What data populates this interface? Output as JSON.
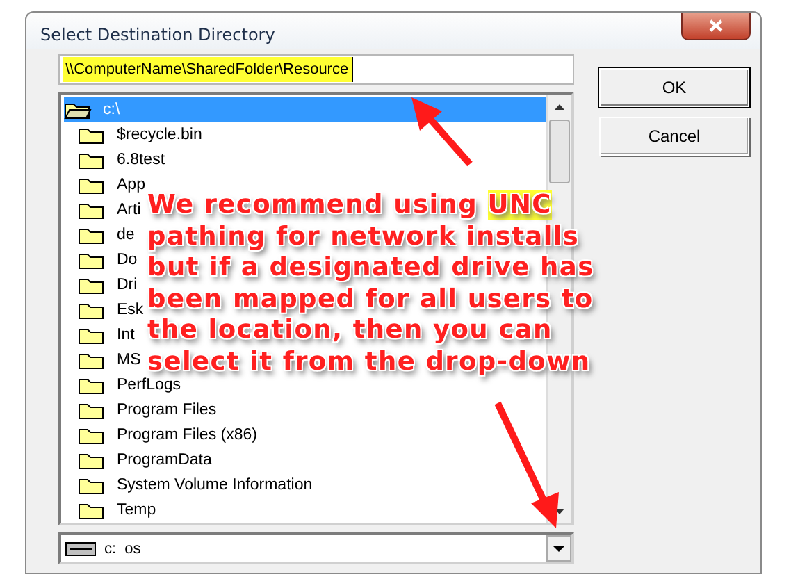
{
  "window": {
    "title": "Select Destination Directory"
  },
  "path_field": {
    "value": "\\\\ComputerName\\SharedFolder\\Resource",
    "highlighted": true
  },
  "buttons": [
    {
      "label": "OK",
      "default": true
    },
    {
      "label": "Cancel",
      "default": false
    }
  ],
  "folder_tree": {
    "label": "c:\\",
    "selected": true,
    "expanded": true,
    "children": [
      {
        "label": "$recycle.bin",
        "selected": false
      },
      {
        "label": "6.8test",
        "selected": false
      },
      {
        "label": "App",
        "selected": false
      },
      {
        "label": "Arti",
        "selected": false
      },
      {
        "label": "de",
        "selected": false
      },
      {
        "label": "Do",
        "selected": false
      },
      {
        "label": "Dri",
        "selected": false
      },
      {
        "label": "Esk",
        "selected": false
      },
      {
        "label": "Int",
        "selected": false
      },
      {
        "label": "MS",
        "selected": false
      },
      {
        "label": "PerfLogs",
        "selected": false
      },
      {
        "label": "Program Files",
        "selected": false
      },
      {
        "label": "Program Files (x86)",
        "selected": false
      },
      {
        "label": "ProgramData",
        "selected": false
      },
      {
        "label": "System Volume Information",
        "selected": false
      },
      {
        "label": "Temp",
        "selected": false
      }
    ]
  },
  "drive_dropdown": {
    "drive": "c:",
    "label": "os"
  },
  "annotation": {
    "lines": [
      {
        "segments": [
          {
            "text": "We recommend using ",
            "highlighted": false
          },
          {
            "text": "UNC",
            "highlighted": true
          }
        ]
      },
      {
        "segments": [
          {
            "text": "pathing for network installs",
            "highlighted": false
          }
        ]
      },
      {
        "segments": [
          {
            "text": "but if a designated drive has",
            "highlighted": false
          }
        ]
      },
      {
        "segments": [
          {
            "text": "been mapped for all users to",
            "highlighted": false
          }
        ]
      },
      {
        "segments": [
          {
            "text": "the location, then you can",
            "highlighted": false
          }
        ]
      },
      {
        "segments": [
          {
            "text": "select it from the drop-down",
            "highlighted": false
          }
        ]
      }
    ]
  }
}
